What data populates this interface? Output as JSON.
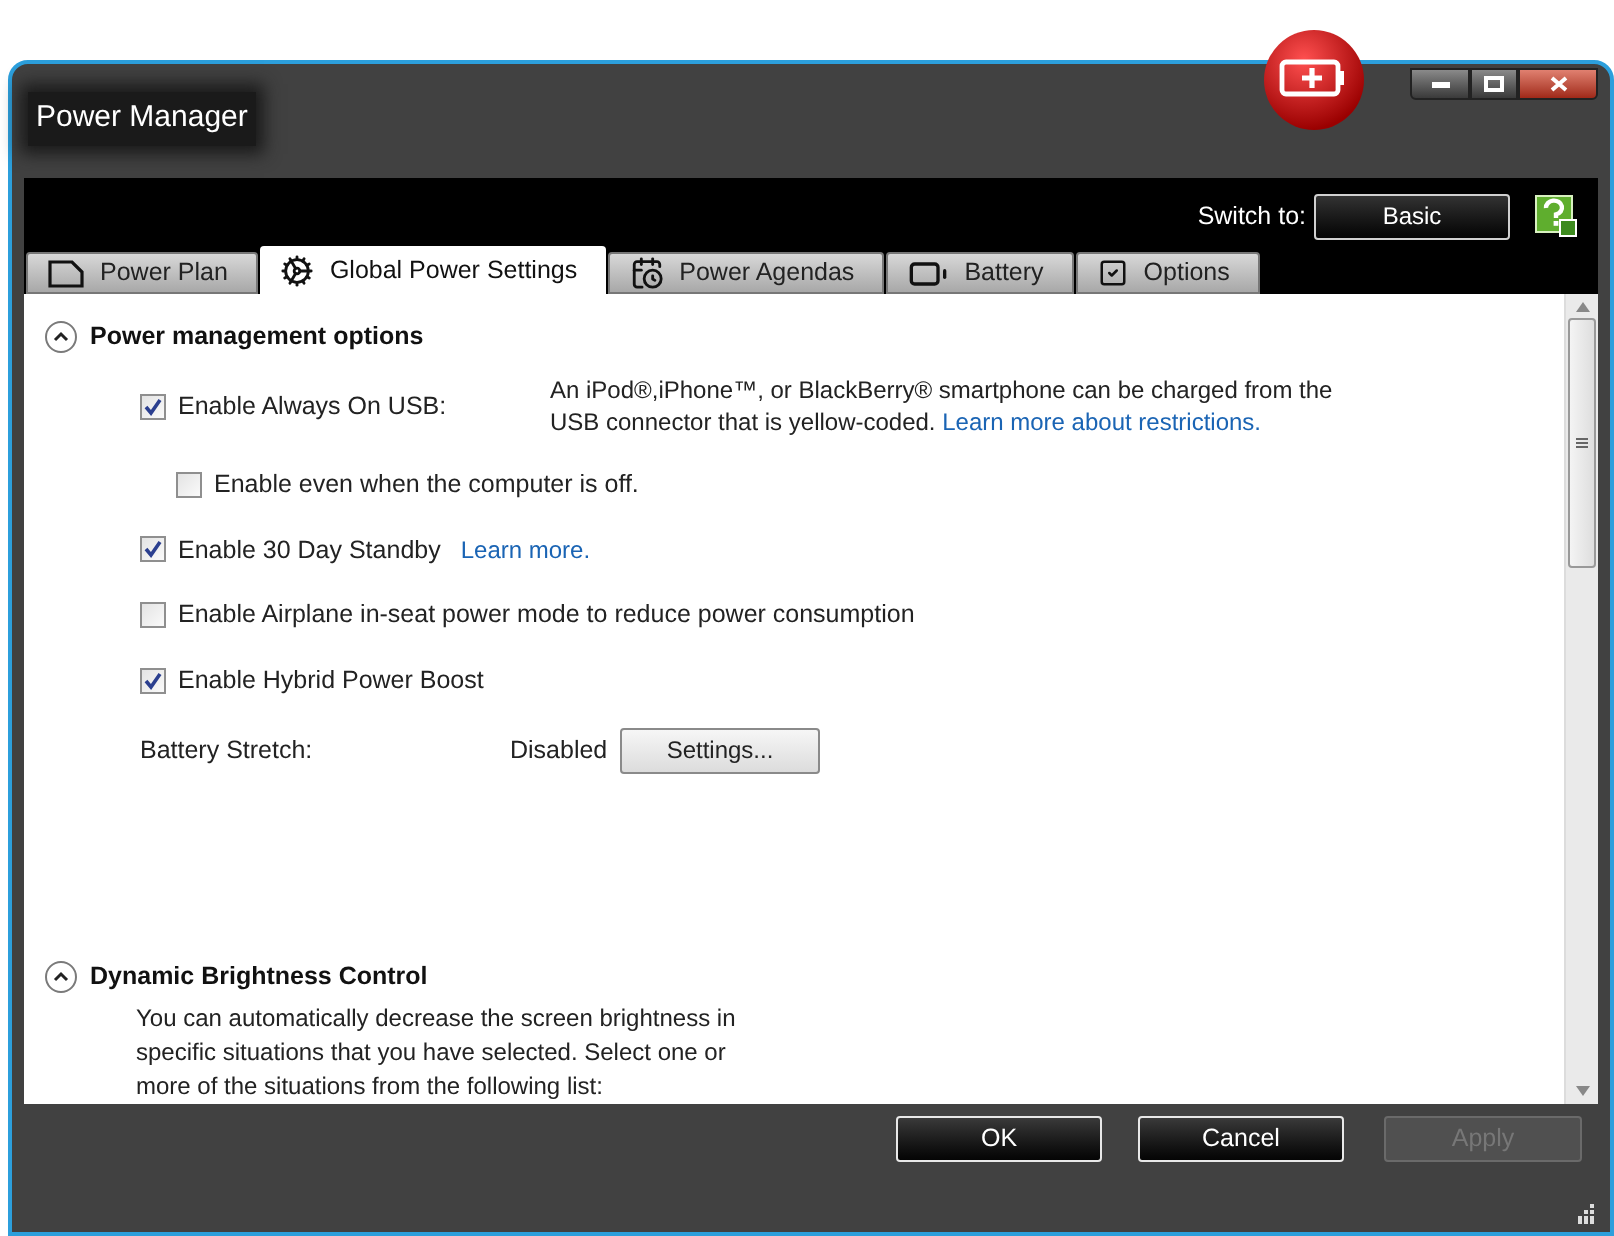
{
  "window": {
    "title": "Power Manager"
  },
  "switch_to": {
    "label": "Switch to:",
    "button": "Basic"
  },
  "tabs": [
    {
      "label": "Power Plan",
      "kind": "plan",
      "selected": false
    },
    {
      "label": "Global Power Settings",
      "kind": "gear",
      "selected": true
    },
    {
      "label": "Power Agendas",
      "kind": "agenda",
      "selected": false
    },
    {
      "label": "Battery",
      "kind": "battery",
      "selected": false
    },
    {
      "label": "Options",
      "kind": "check",
      "selected": false
    }
  ],
  "sections": [
    {
      "title": "Power management options",
      "expanded": true,
      "items": [
        {
          "kind": "checkbox",
          "label": "Enable Always On USB:",
          "checked": true,
          "description": "An iPod®,iPhone™, or BlackBerry® smartphone can be charged from the USB connector that is yellow-coded.",
          "link": "Learn more about restrictions.",
          "children": [
            {
              "kind": "checkbox",
              "label": "Enable even when the computer is off.",
              "checked": false
            }
          ]
        },
        {
          "kind": "checkbox",
          "label": "Enable 30 Day Standby",
          "checked": true,
          "link": "Learn more."
        },
        {
          "kind": "checkbox",
          "label": "Enable Airplane in-seat power mode to reduce power consumption",
          "checked": false
        },
        {
          "kind": "checkbox",
          "label": "Enable Hybrid Power Boost",
          "checked": true
        },
        {
          "kind": "setting",
          "label": "Battery Stretch:",
          "value": "Disabled",
          "button": "Settings..."
        }
      ]
    },
    {
      "title": "Dynamic Brightness Control",
      "expanded": true,
      "description": "You can automatically decrease the screen brightness in specific situations that you have selected. Select one or more of the situations from the following list:"
    }
  ],
  "buttons": [
    {
      "label": "OK",
      "disabled": false
    },
    {
      "label": "Cancel",
      "disabled": false
    },
    {
      "label": "Apply",
      "disabled": true
    }
  ]
}
